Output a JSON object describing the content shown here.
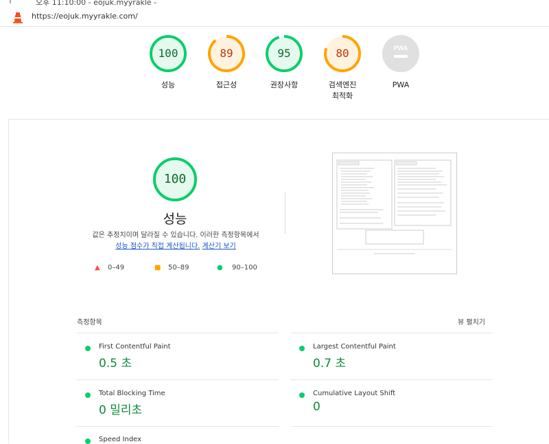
{
  "browser": {
    "top_text": "오후 11:10:00 - eojuk.myyrakle -",
    "url": "https://eojuk.myyrakle.com/"
  },
  "gauges": [
    {
      "score": "100",
      "label": "성능",
      "color": "#0cce6b",
      "text_color": "#0c6b2f",
      "fill": "#e6f9ee",
      "pct": 1.0
    },
    {
      "score": "89",
      "label": "접근성",
      "color": "#ffa400",
      "text_color": "#c33300",
      "fill": "#fff3e0",
      "pct": 0.89
    },
    {
      "score": "95",
      "label": "권장사항",
      "color": "#0cce6b",
      "text_color": "#0c6b2f",
      "fill": "#e6f9ee",
      "pct": 0.95
    },
    {
      "score": "80",
      "label": "검색엔진 최적화",
      "label_l1": "검색엔진",
      "label_l2": "최적화",
      "color": "#ffa400",
      "text_color": "#c33300",
      "fill": "#fff3e0",
      "pct": 0.8
    },
    {
      "score": "",
      "label": "PWA",
      "badge_text": "PWA",
      "color": "#d0d0d0",
      "fill": "#e8e8e8",
      "pct": 0
    }
  ],
  "performance": {
    "score": "100",
    "title": "성능",
    "desc_line1": "값은 추정치이며 달라질 수 있습니다. 이러한 측정항목에서",
    "link1": "성능 점수가 직접 계산됩니다.",
    "link2": "계산기 보기"
  },
  "legend": [
    {
      "symbol": "▲",
      "range": "0–49",
      "color": "#ff4e42"
    },
    {
      "symbol": "■",
      "range": "50–89",
      "color": "#ffa400"
    },
    {
      "symbol": "●",
      "range": "90–100",
      "color": "#0cce6b"
    }
  ],
  "metrics_header": "측정항목",
  "expand_label": "뷰 펼치기",
  "metrics": [
    {
      "name": "First Contentful Paint",
      "value": "0.5 초"
    },
    {
      "name": "Largest Contentful Paint",
      "value": "0.7 초"
    },
    {
      "name": "Total Blocking Time",
      "value": "0 밀리초"
    },
    {
      "name": "Cumulative Layout Shift",
      "value": "0"
    },
    {
      "name": "Speed Index",
      "value": ""
    }
  ]
}
